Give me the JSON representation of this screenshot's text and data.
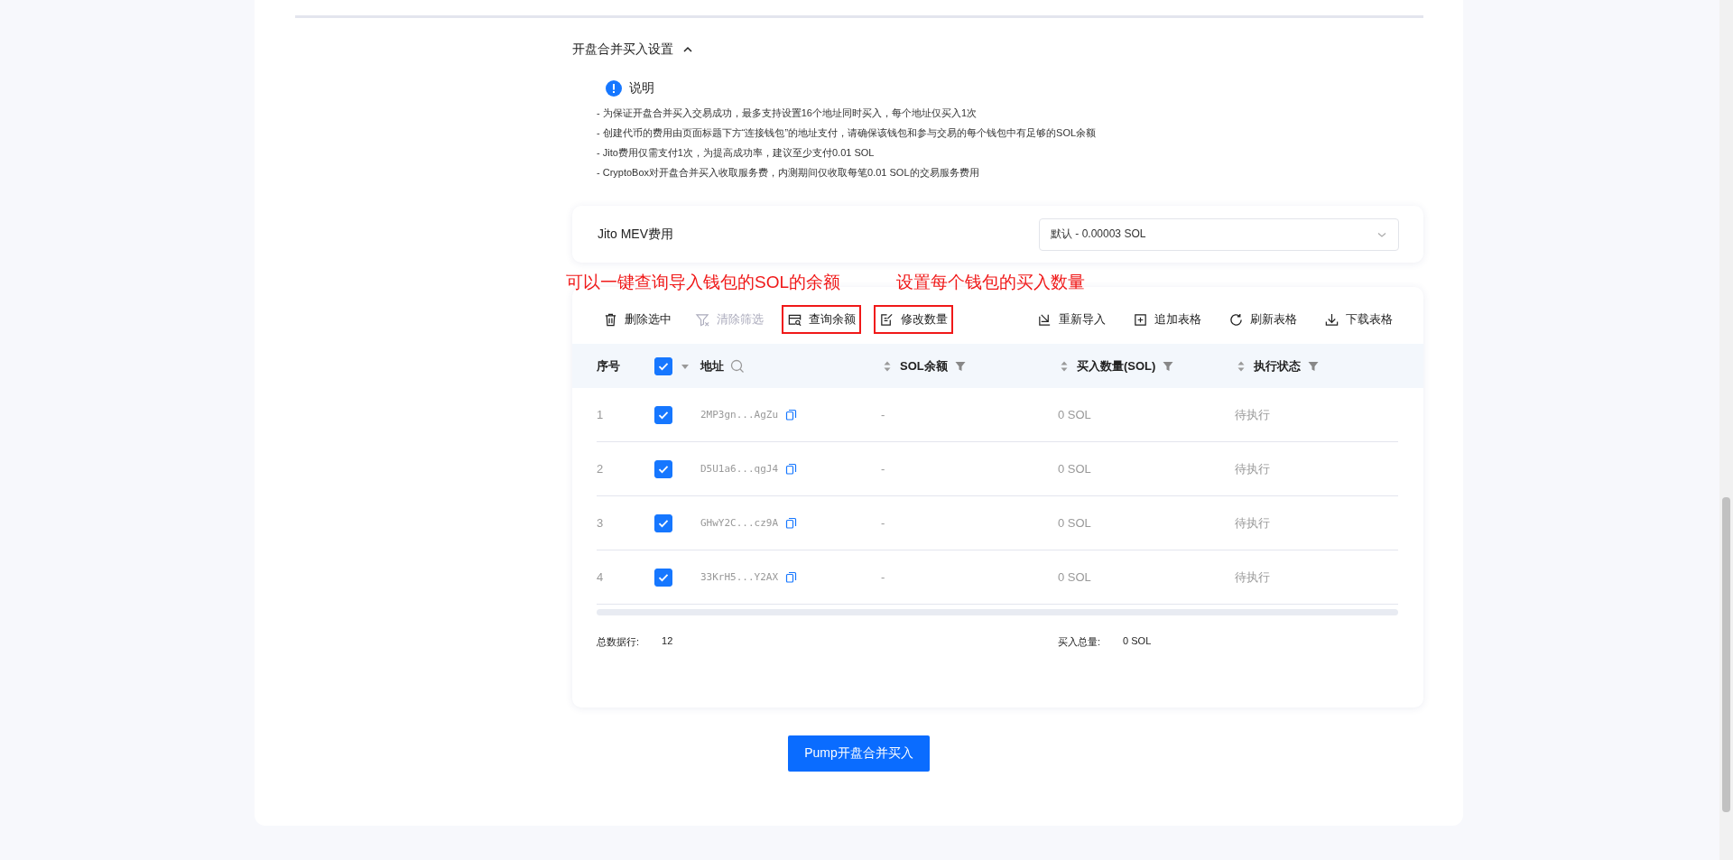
{
  "section": {
    "title": "开盘合并买入设置",
    "expanded": true
  },
  "notice": {
    "title": "说明",
    "lines": [
      "- 为保证开盘合并买入交易成功，最多支持设置16个地址同时买入，每个地址仅买入1次",
      "- 创建代币的费用由页面标题下方“连接钱包”的地址支付，请确保该钱包和参与交易的每个钱包中有足够的SOL余额",
      "- Jito费用仅需支付1次，为提高成功率，建议至少支付0.01 SOL",
      "- CryptoBox对开盘合并买入收取服务费，内测期间仅收取每笔0.01 SOL的交易服务费用"
    ]
  },
  "jito": {
    "label": "Jito MEV费用",
    "value": "默认 - 0.00003 SOL"
  },
  "annotations": [
    "可以一键查询导入钱包的SOL的余额",
    "设置每个钱包的买入数量"
  ],
  "toolbar": {
    "left": [
      {
        "label": "删除选中",
        "kind": "trash",
        "disabled": false,
        "annotated": false
      },
      {
        "label": "清除筛选",
        "kind": "clear-filter",
        "disabled": true,
        "annotated": false
      },
      {
        "label": "查询余额",
        "kind": "query",
        "disabled": false,
        "annotated": true
      },
      {
        "label": "修改数量",
        "kind": "edit",
        "disabled": false,
        "annotated": true
      }
    ],
    "right": [
      {
        "label": "重新导入",
        "kind": "import",
        "disabled": false,
        "annotated": false
      },
      {
        "label": "追加表格",
        "kind": "add",
        "disabled": false,
        "annotated": false
      },
      {
        "label": "刷新表格",
        "kind": "refresh",
        "disabled": false,
        "annotated": false
      },
      {
        "label": "下载表格",
        "kind": "download",
        "disabled": false,
        "annotated": false
      }
    ]
  },
  "table": {
    "columns": [
      {
        "label": "序号",
        "kind": "plain"
      },
      {
        "kind": "check",
        "checked": true
      },
      {
        "label": "地址",
        "kind": "search"
      },
      {
        "label": "SOL余额",
        "kind": "sortfilter"
      },
      {
        "label": "买入数量(SOL)",
        "kind": "sortfilter"
      },
      {
        "label": "执行状态",
        "kind": "sortfilter"
      }
    ],
    "rows": [
      {
        "index": "1",
        "checked": true,
        "address": "2MP3gn...AgZu",
        "balance": "-",
        "amount": "0 SOL",
        "status": "待执行"
      },
      {
        "index": "2",
        "checked": true,
        "address": "D5U1a6...qgJ4",
        "balance": "-",
        "amount": "0 SOL",
        "status": "待执行"
      },
      {
        "index": "3",
        "checked": true,
        "address": "GHwY2C...cz9A",
        "balance": "-",
        "amount": "0 SOL",
        "status": "待执行"
      },
      {
        "index": "4",
        "checked": true,
        "address": "33KrH5...Y2AX",
        "balance": "-",
        "amount": "0 SOL",
        "status": "待执行"
      }
    ]
  },
  "summary": [
    {
      "label": "总数据行:",
      "value": "12"
    },
    {
      "label": "买入总量:",
      "value": "0 SOL"
    }
  ],
  "submit_button": "Pump开盘合并买入"
}
